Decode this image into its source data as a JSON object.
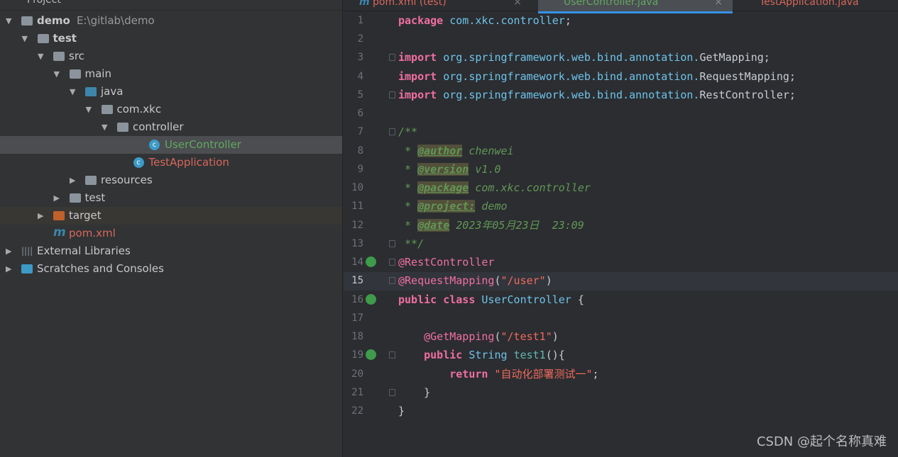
{
  "sidebar": {
    "title": "Project",
    "items": [
      {
        "label": "demo",
        "path": "E:\\gitlab\\demo"
      },
      {
        "label": "test"
      },
      {
        "label": "src"
      },
      {
        "label": "main"
      },
      {
        "label": "java"
      },
      {
        "label": "com.xkc"
      },
      {
        "label": "controller"
      },
      {
        "label": "UserController"
      },
      {
        "label": "TestApplication"
      },
      {
        "label": "resources"
      },
      {
        "label": "test"
      },
      {
        "label": "target"
      },
      {
        "label": "pom.xml"
      },
      {
        "label": "External Libraries"
      },
      {
        "label": "Scratches and Consoles"
      }
    ]
  },
  "tabs": [
    {
      "label": "pom.xml (test)"
    },
    {
      "label": "UserController.java",
      "active": true
    },
    {
      "label": "TestApplication.java"
    }
  ],
  "editor": {
    "current_line": 15,
    "lines": [
      "package com.xkc.controller;",
      "",
      "import org.springframework.web.bind.annotation.GetMapping;",
      "import org.springframework.web.bind.annotation.RequestMapping;",
      "import org.springframework.web.bind.annotation.RestController;",
      "",
      "/**",
      " * @author chenwei",
      " * @version v1.0",
      " * @package com.xkc.controller",
      " * @project: demo",
      " * @date 2023年05月23日  23:09",
      " **/",
      "@RestController",
      "@RequestMapping(\"/user\")",
      "public class UserController {",
      "",
      "    @GetMapping(\"/test1\")",
      "    public String test1(){",
      "        return \"自动化部署测试一\";",
      "    }",
      "}"
    ]
  },
  "watermark": "CSDN @起个名称真难",
  "colors": {
    "keyword": "#ef6fa0",
    "identifier": "#6fc3e8",
    "string": "#ef6a5c",
    "comment": "#629755",
    "accent": "#3592e8"
  }
}
